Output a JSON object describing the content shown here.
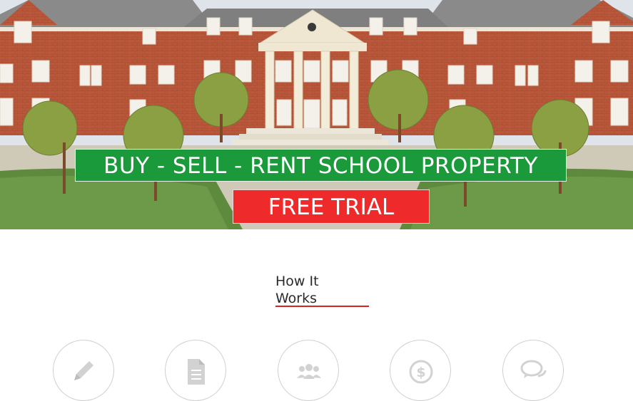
{
  "hero": {
    "banner_text": "BUY - SELL - RENT SCHOOL PROPERTY",
    "trial_button": "FREE TRIAL",
    "banner_color": "#1a9a3a",
    "trial_color": "#ef2a2a"
  },
  "how_it_works": {
    "title_line1": "How It",
    "title_line2": "Works",
    "underline_color": "#d62424"
  },
  "steps": [
    {
      "icon": "pencil-icon"
    },
    {
      "icon": "document-icon"
    },
    {
      "icon": "group-icon"
    },
    {
      "icon": "dollar-icon"
    },
    {
      "icon": "chat-bubbles-icon"
    }
  ]
}
